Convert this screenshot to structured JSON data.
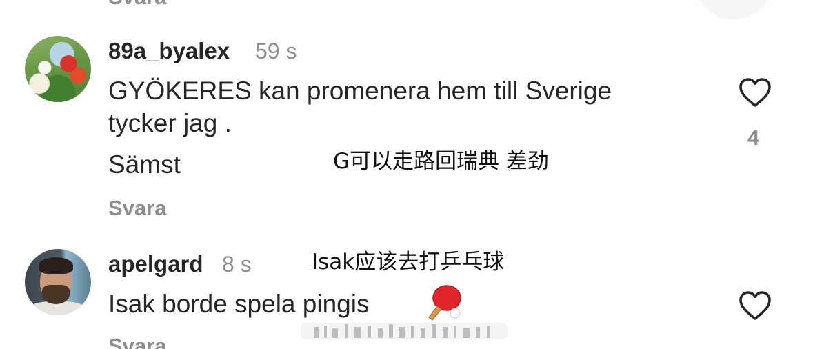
{
  "top": {
    "reply_fragment": "Svara"
  },
  "comments": [
    {
      "username": "89a_byalex",
      "time": "59 s",
      "lines": [
        "GYÖKERES kan promenera hem till Sverige",
        "tycker jag .",
        "Sämst"
      ],
      "reply_label": "Svara",
      "like_count": "4",
      "avatar": "avatar-flowers",
      "overlay_translation": "G可以走路回瑞典 差劲"
    },
    {
      "username": "apelgard",
      "time": "8 s",
      "lines": [
        "Isak borde spela pingis"
      ],
      "emoji": "ping-pong-paddle",
      "reply_label": "Svara",
      "avatar": "avatar-man-beard",
      "overlay_translation": "Isak应该去打乒乓球"
    }
  ],
  "icons": {
    "like": "heart-outline-icon"
  },
  "colors": {
    "text": "#262626",
    "secondary": "#8e8e8e",
    "background": "#ffffff"
  }
}
